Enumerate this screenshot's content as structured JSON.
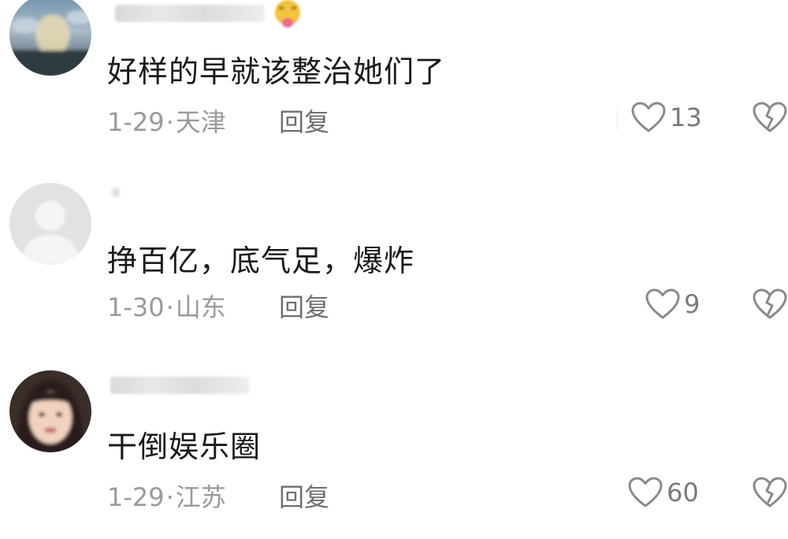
{
  "comments": [
    {
      "username": "",
      "text": "好样的早就该整治她们了",
      "date": "1-29",
      "separator": "·",
      "location": "天津",
      "reply_label": "回复",
      "likes": "13",
      "avatar_icon": "landscape-avatar-icon",
      "has_emoji_badge": true
    },
    {
      "username": "",
      "text": "挣百亿，底气足，爆炸",
      "date": "1-30",
      "separator": "·",
      "location": "山东",
      "reply_label": "回复",
      "likes": "9",
      "avatar_icon": "default-user-avatar-icon",
      "has_emoji_badge": false
    },
    {
      "username": "",
      "text": "干倒娱乐圈",
      "date": "1-29",
      "separator": "·",
      "location": "江苏",
      "reply_label": "回复",
      "likes": "60",
      "avatar_icon": "portrait-avatar-icon",
      "has_emoji_badge": false
    }
  ],
  "colors": {
    "text": "#1a1a1a",
    "meta": "#9a9a9a",
    "reply": "#6f6f6f",
    "icon": "#8a8a8a"
  },
  "icons": {
    "like": "heart-outline-icon",
    "dislike": "broken-heart-outline-icon"
  }
}
